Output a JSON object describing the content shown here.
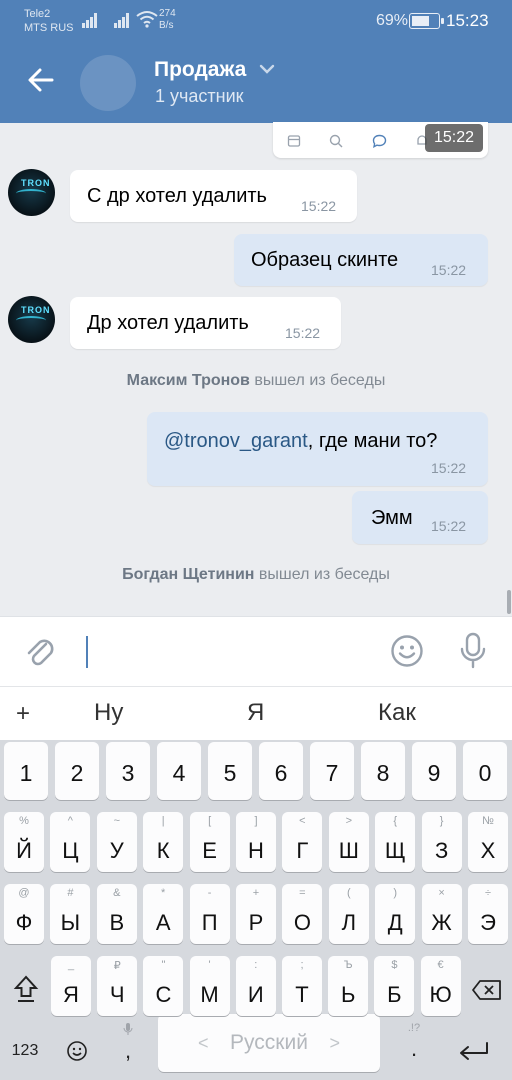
{
  "status_bar": {
    "carrier1": "Tele2",
    "carrier2": "MTS RUS",
    "speed_value": "274",
    "speed_unit": "B/s",
    "battery_percent": "69%",
    "battery_level": 0.69,
    "time": "15:23"
  },
  "header": {
    "title": "Продажа",
    "subtitle": "1 участник"
  },
  "pinned_time_chip": "15:22",
  "messages": [
    {
      "direction": "in",
      "text": "С др хотел удалить",
      "time": "15:22"
    },
    {
      "direction": "out",
      "text": "Образец скинте",
      "time": "15:22"
    },
    {
      "direction": "in",
      "text": "Др хотел удалить",
      "time": "15:22"
    },
    {
      "direction": "system",
      "name": "Максим Тронов",
      "action": "вышел из беседы"
    },
    {
      "direction": "out",
      "mention": "@tronov_garant",
      "text": ", где мани то?",
      "time": "15:22"
    },
    {
      "direction": "out",
      "text": "Эмм",
      "time": "15:22"
    },
    {
      "direction": "system",
      "name": "Богдан Щетинин",
      "action": "вышел из беседы"
    }
  ],
  "avatar_text": "TRON",
  "suggestions": {
    "plus": "+",
    "items": [
      "Ну",
      "Я",
      "Как"
    ]
  },
  "keyboard": {
    "numbers": [
      "1",
      "2",
      "3",
      "4",
      "5",
      "6",
      "7",
      "8",
      "9",
      "0"
    ],
    "row1": [
      [
        "Й",
        "%"
      ],
      [
        "Ц",
        "^"
      ],
      [
        "У",
        "~"
      ],
      [
        "К",
        "|"
      ],
      [
        "Е",
        "["
      ],
      [
        "Н",
        "]"
      ],
      [
        "Г",
        "<"
      ],
      [
        "Ш",
        ">"
      ],
      [
        "Щ",
        "{"
      ],
      [
        "З",
        "}"
      ],
      [
        "Х",
        "№"
      ]
    ],
    "row2": [
      [
        "Ф",
        "@"
      ],
      [
        "Ы",
        "#"
      ],
      [
        "В",
        "&"
      ],
      [
        "А",
        "*"
      ],
      [
        "П",
        "-"
      ],
      [
        "Р",
        "+"
      ],
      [
        "О",
        "="
      ],
      [
        "Л",
        "("
      ],
      [
        "Д",
        ")"
      ],
      [
        "Ж",
        "×"
      ],
      [
        "Э",
        "÷"
      ]
    ],
    "row3": [
      [
        "Я",
        "_"
      ],
      [
        "Ч",
        "₽"
      ],
      [
        "С",
        "\""
      ],
      [
        "М",
        "'"
      ],
      [
        "И",
        ":"
      ],
      [
        "Т",
        ";"
      ],
      [
        "Ь",
        "Ъ"
      ],
      [
        "Б",
        "$"
      ],
      [
        "Ю",
        "€"
      ]
    ],
    "mode_key": "123",
    "comma": ",",
    "space_label": "Русский",
    "punct_hint": ".!?",
    "space_left": "<",
    "space_right": ">"
  }
}
